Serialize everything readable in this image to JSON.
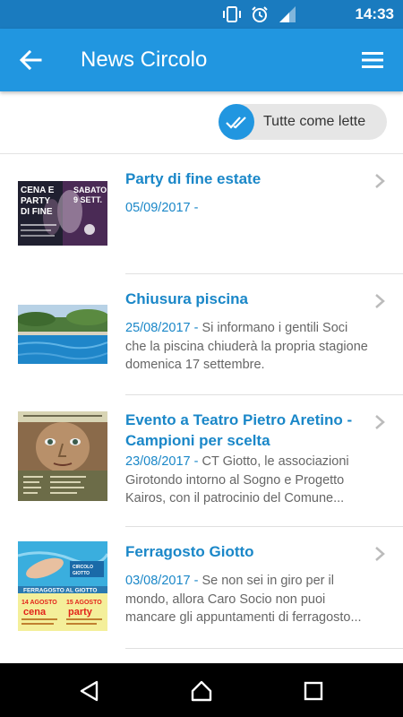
{
  "status_bar": {
    "time": "14:33",
    "icons": [
      "vibrate-icon",
      "alarm-icon",
      "signal-icon"
    ]
  },
  "app_bar": {
    "title": "News Circolo",
    "back_icon": "arrow-left-icon",
    "menu_icon": "hamburger-menu-icon"
  },
  "mark_all": {
    "label": "Tutte come lette",
    "icon": "double-check-icon"
  },
  "colors": {
    "status_bar": "#1a7bbf",
    "app_bar": "#2196e0",
    "accent": "#1a87c8",
    "chip_bg": "#e6e6e6"
  },
  "news": [
    {
      "title": "Party di fine estate",
      "date": "05/09/2017",
      "separator": " - ",
      "excerpt": "",
      "thumb_text": [
        "CENA E",
        "PARTY",
        "DI FINE",
        "SABATO",
        "9 SETT."
      ]
    },
    {
      "title": "Chiusura piscina",
      "date": "25/08/2017",
      "separator": " - ",
      "excerpt": "Si informano i gentili Soci che la piscina chiuderà la propria stagione domenica 17 settembre.",
      "thumb_text": []
    },
    {
      "title": "Evento a Teatro Pietro Aretino - Campioni per scelta",
      "date": "23/08/2017",
      "separator": " - ",
      "excerpt": "CT Giotto, le associazioni Girotondo intorno al Sogno e Progetto Kairos, con il patrocinio del Comune...",
      "thumb_text": []
    },
    {
      "title": "Ferragosto Giotto",
      "date": "03/08/2017",
      "separator": " - ",
      "excerpt": "Se non sei in giro per il mondo, allora Caro Socio non puoi mancare gli appuntamenti di ferragosto...",
      "thumb_text": [
        "FERRAGOSTO AL GIOTTO",
        "cena",
        "party"
      ]
    }
  ],
  "nav_bar": {
    "back_icon": "nav-back-icon",
    "home_icon": "nav-home-icon",
    "recents_icon": "nav-recents-icon"
  }
}
